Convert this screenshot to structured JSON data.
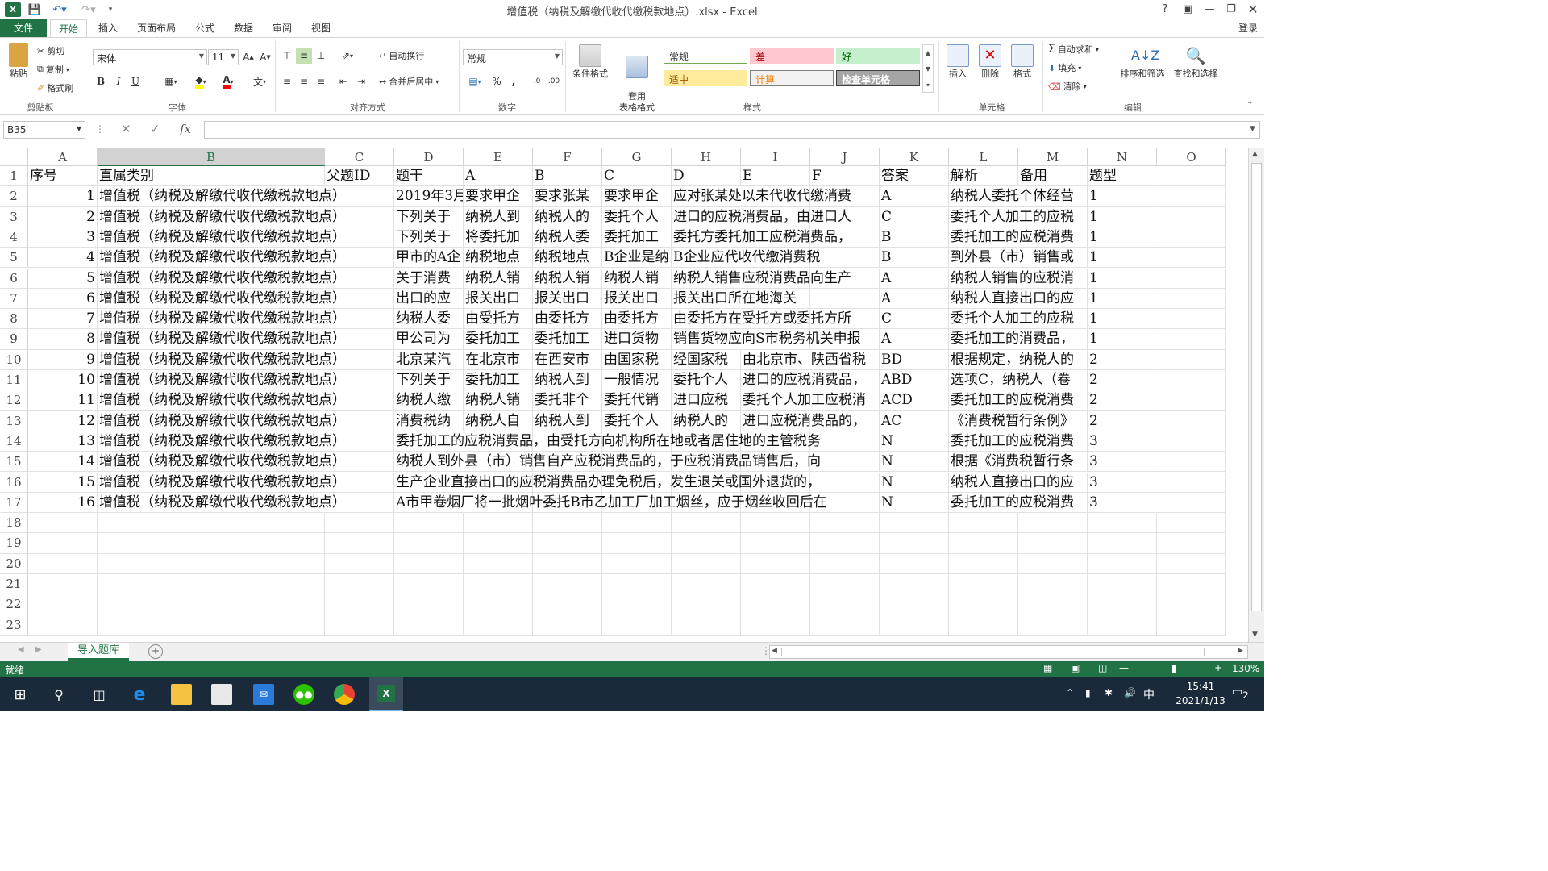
{
  "window": {
    "title": "增值税（纳税及解缴代收代缴税款地点）.xlsx - Excel",
    "help": "?",
    "login": "登录"
  },
  "tabs": [
    {
      "label": "文件",
      "id": "file"
    },
    {
      "label": "开始",
      "id": "home",
      "active": true
    },
    {
      "label": "插入",
      "id": "insert"
    },
    {
      "label": "页面布局",
      "id": "page-layout"
    },
    {
      "label": "公式",
      "id": "formulas"
    },
    {
      "label": "数据",
      "id": "data"
    },
    {
      "label": "审阅",
      "id": "review"
    },
    {
      "label": "视图",
      "id": "view"
    }
  ],
  "ribbon": {
    "clipboard": {
      "paste": "粘贴",
      "cut": "剪切",
      "copy": "复制",
      "format_painter": "格式刷",
      "label": "剪贴板"
    },
    "font": {
      "name": "宋体",
      "size": "11",
      "label": "字体",
      "bold": "B",
      "italic": "I",
      "underline": "U"
    },
    "alignment": {
      "wrap": "自动换行",
      "merge": "合并后居中",
      "label": "对齐方式"
    },
    "number": {
      "format": "常规",
      "label": "数字",
      "percent": "%",
      "comma": ","
    },
    "styles": {
      "conditional": "条件格式",
      "table_format": "套用\n表格格式",
      "items": [
        {
          "label": "常规",
          "bg": "#ffffff",
          "color": "#333333",
          "border": "#70ad47"
        },
        {
          "label": "差",
          "bg": "#ffc7ce",
          "color": "#9c0006",
          "border": "#ffc7ce"
        },
        {
          "label": "好",
          "bg": "#c6efce",
          "color": "#006100",
          "border": "#c6efce"
        },
        {
          "label": "适中",
          "bg": "#ffeb9c",
          "color": "#9c5700",
          "border": "#ffeb9c"
        },
        {
          "label": "计算",
          "bg": "#f2f2f2",
          "color": "#fa7d00",
          "border": "#7f7f7f"
        },
        {
          "label": "检查单元格",
          "bg": "#a5a5a5",
          "color": "#ffffff",
          "border": "#3f3f3f"
        }
      ],
      "label": "样式"
    },
    "cells": {
      "insert": "插入",
      "delete": "删除",
      "format": "格式",
      "label": "单元格"
    },
    "editing": {
      "autosum": "自动求和",
      "fill": "填充",
      "clear": "清除",
      "sort": "排序和筛选",
      "find": "查找和选择",
      "label": "编辑"
    }
  },
  "formula_bar": {
    "name_box": "B35",
    "fx": "fx",
    "content": ""
  },
  "columns": [
    "A",
    "B",
    "C",
    "D",
    "E",
    "F",
    "G",
    "H",
    "I",
    "J",
    "K",
    "L",
    "M",
    "N",
    "O"
  ],
  "selected_column": "B",
  "header_row": [
    "序号",
    "直属类别",
    "父题ID",
    "题干",
    "A",
    "B",
    "C",
    "D",
    "E",
    "F",
    "答案",
    "解析",
    "备用",
    "题型",
    ""
  ],
  "rows": [
    [
      "1",
      "增值税（纳税及解缴代收代缴税款地点）",
      "",
      "2019年3月",
      "要求甲企",
      "要求张某",
      "要求甲企",
      "应对张某处以未代收代缴消费",
      "",
      "",
      "A",
      "纳税人委托个体经营",
      "",
      "1",
      ""
    ],
    [
      "2",
      "增值税（纳税及解缴代收代缴税款地点）",
      "",
      "下列关于",
      "纳税人到",
      "纳税人的",
      "委托个人",
      "进口的应税消费品，由进口人",
      "",
      "",
      "C",
      "委托个人加工的应税",
      "",
      "1",
      ""
    ],
    [
      "3",
      "增值税（纳税及解缴代收代缴税款地点）",
      "",
      "下列关于",
      "将委托加",
      "纳税人委",
      "委托加工",
      "委托方委托加工应税消费品，",
      "",
      "",
      "B",
      "委托加工的应税消费",
      "",
      "1",
      ""
    ],
    [
      "4",
      "增值税（纳税及解缴代收代缴税款地点）",
      "",
      "甲市的A企",
      "纳税地点",
      "纳税地点",
      "B企业是纳",
      "B企业应代收代缴消费税",
      "",
      "",
      "B",
      "到外县（市）销售或",
      "",
      "1",
      ""
    ],
    [
      "5",
      "增值税（纳税及解缴代收代缴税款地点）",
      "",
      "关于消费",
      "纳税人销",
      "纳税人销",
      "纳税人销",
      "纳税人销售应税消费品向生产",
      "",
      "",
      "A",
      "纳税人销售的应税消",
      "",
      "1",
      ""
    ],
    [
      "6",
      "增值税（纳税及解缴代收代缴税款地点）",
      "",
      "出口的应",
      "报关出口",
      "报关出口",
      "报关出口",
      "报关出口所在地海关",
      "",
      "",
      "A",
      "纳税人直接出口的应",
      "",
      "1",
      ""
    ],
    [
      "7",
      "增值税（纳税及解缴代收代缴税款地点）",
      "",
      "纳税人委",
      "由受托方",
      "由委托方",
      "由委托方",
      "由委托方在受托方或委托方所",
      "",
      "",
      "C",
      "委托个人加工的应税",
      "",
      "1",
      ""
    ],
    [
      "8",
      "增值税（纳税及解缴代收代缴税款地点）",
      "",
      "甲公司为",
      "委托加工",
      "委托加工",
      "进口货物",
      "销售货物应向S市税务机关申报",
      "",
      "",
      "A",
      "委托加工的消费品，",
      "",
      "1",
      ""
    ],
    [
      "9",
      "增值税（纳税及解缴代收代缴税款地点）",
      "",
      "北京某汽",
      "在北京市",
      "在西安市",
      "由国家税",
      "经国家税",
      "由北京市、陕西省税",
      "",
      "BD",
      "根据规定，纳税人的",
      "",
      "2",
      ""
    ],
    [
      "10",
      "增值税（纳税及解缴代收代缴税款地点）",
      "",
      "下列关于",
      "委托加工",
      "纳税人到",
      "一般情况",
      "委托个人",
      "进口的应税消费品，",
      "",
      "ABD",
      "选项C，纳税人（卷",
      "",
      "2",
      ""
    ],
    [
      "11",
      "增值税（纳税及解缴代收代缴税款地点）",
      "",
      "纳税人缴",
      "纳税人销",
      "委托非个",
      "委托代销",
      "进口应税",
      "委托个人加工应税消",
      "",
      "ACD",
      "委托加工的应税消费",
      "",
      "2",
      ""
    ],
    [
      "12",
      "增值税（纳税及解缴代收代缴税款地点）",
      "",
      "消费税纳",
      "纳税人自",
      "纳税人到",
      "委托个人",
      "纳税人的",
      "进口应税消费品的，",
      "",
      "AC",
      "《消费税暂行条例》",
      "",
      "2",
      ""
    ],
    [
      "13",
      "增值税（纳税及解缴代收代缴税款地点）",
      "",
      "委托加工的应税消费品，由受托方向机构所在地或者居住地的主管税务",
      "",
      "",
      "",
      "",
      "",
      "",
      "N",
      "委托加工的应税消费",
      "",
      "3",
      ""
    ],
    [
      "14",
      "增值税（纳税及解缴代收代缴税款地点）",
      "",
      "纳税人到外县（市）销售自产应税消费品的，于应税消费品销售后，向",
      "",
      "",
      "",
      "",
      "",
      "",
      "N",
      "根据《消费税暂行条",
      "",
      "3",
      ""
    ],
    [
      "15",
      "增值税（纳税及解缴代收代缴税款地点）",
      "",
      "生产企业直接出口的应税消费品办理免税后，发生退关或国外退货的，",
      "",
      "",
      "",
      "",
      "",
      "",
      "N",
      "纳税人直接出口的应",
      "",
      "3",
      ""
    ],
    [
      "16",
      "增值税（纳税及解缴代收代缴税款地点）",
      "",
      "A市甲卷烟厂将一批烟叶委托B市乙加工厂加工烟丝，应于烟丝收回后在",
      "",
      "",
      "",
      "",
      "",
      "",
      "N",
      "委托加工的应税消费",
      "",
      "3",
      ""
    ]
  ],
  "row_numbers": [
    "1",
    "2",
    "3",
    "4",
    "5",
    "6",
    "7",
    "8",
    "9",
    "10",
    "11",
    "12",
    "13",
    "14",
    "15",
    "16",
    "17",
    "18",
    "19",
    "20",
    "21",
    "22",
    "23"
  ],
  "sheet_tab": "导入题库",
  "status": {
    "ready": "就绪",
    "zoom": "130%"
  },
  "taskbar": {
    "time": "15:41",
    "date": "2021/1/13",
    "ime": "中",
    "notifications": "2"
  },
  "accent_color": "#217346"
}
